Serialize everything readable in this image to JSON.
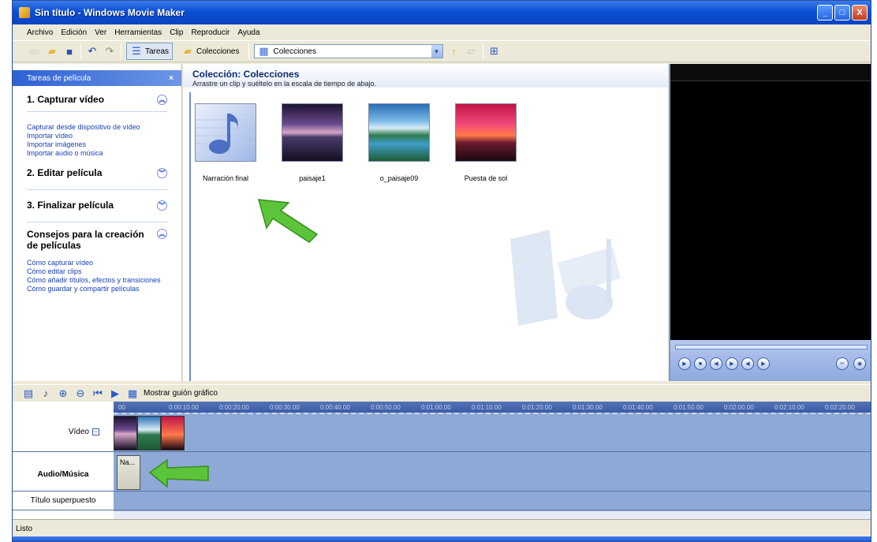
{
  "window": {
    "title": "Sin título - Windows Movie Maker",
    "minimize": "_",
    "maximize": "□",
    "close": "X"
  },
  "menu": [
    "Archivo",
    "Edición",
    "Ver",
    "Herramientas",
    "Clip",
    "Reproducir",
    "Ayuda"
  ],
  "toolbar": {
    "tareas": "Tareas",
    "colecciones_btn": "Colecciones",
    "colecciones_select": "Colecciones"
  },
  "tasks": {
    "header": "Tareas de película",
    "close": "×",
    "sections": [
      {
        "title": "1. Capturar vídeo",
        "links": [
          "Capturar desde dispositivo de vídeo",
          "Importar vídeo",
          "Importar imágenes",
          "Importar audio o música"
        ]
      },
      {
        "title": "2. Editar película",
        "links": []
      },
      {
        "title": "3. Finalizar película",
        "links": []
      },
      {
        "title": "Consejos para la creación de películas",
        "links": [
          "Cómo capturar vídeo",
          "Cómo editar clips",
          "Cómo añadir títulos, efectos y transiciones",
          "Cómo guardar y compartir películas"
        ]
      }
    ]
  },
  "collection": {
    "title": "Colección: Colecciones",
    "subtitle": "Arrastre un clip y suéltelo en la escala de tiempo de abajo.",
    "clips": [
      {
        "name": "Narración final",
        "kind": "music-note"
      },
      {
        "name": "paisaje1",
        "kind": "landscape-dusk"
      },
      {
        "name": "o_paisaje09",
        "kind": "landscape-mountain"
      },
      {
        "name": "Puesta de sol",
        "kind": "sunset"
      }
    ]
  },
  "timeline": {
    "storyboard_label": "Mostrar guión gráfico",
    "ruler": [
      "00",
      "0:00:10.00",
      "0:00:20.00",
      "0:00:30.00",
      "0:00:40.00",
      "0:00:50.00",
      "0:01:00.00",
      "0:01:10.00",
      "0:01:20.00",
      "0:01:30.00",
      "0:01:40.00",
      "0:01:50.00",
      "0:02:00.00",
      "0:02:10.00",
      "0:02:20.00"
    ],
    "tracks": {
      "video": "Vídeo",
      "audio": "Audio/Música",
      "title": "Título superpuesto"
    },
    "audio_clip_label": "Na..."
  },
  "status": "Listo",
  "colors": {
    "accent": "#0a4fd6",
    "timeline": "#8ea9d6",
    "arrow": "#5cc43a"
  }
}
